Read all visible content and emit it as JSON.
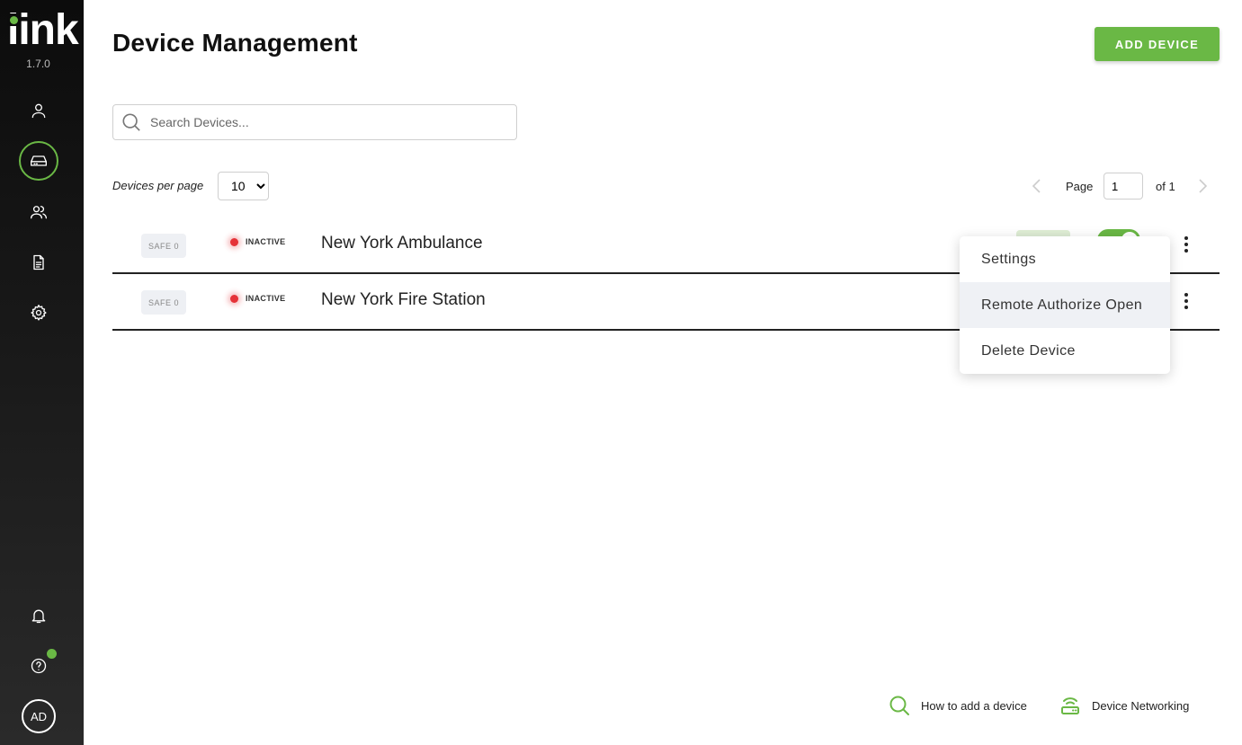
{
  "app": {
    "logo_text": "link",
    "version": "1.7.0",
    "accent_color": "#6ab845"
  },
  "sidebar": {
    "items": [
      {
        "name": "profile",
        "icon": "user-icon",
        "active": false
      },
      {
        "name": "devices",
        "icon": "device-icon",
        "active": true
      },
      {
        "name": "users",
        "icon": "users-icon",
        "active": false
      },
      {
        "name": "logs",
        "icon": "document-icon",
        "active": false
      },
      {
        "name": "settings",
        "icon": "gear-icon",
        "active": false
      }
    ],
    "bottom": {
      "notifications_icon": "bell-icon",
      "help_icon": "help-icon",
      "help_badge": true,
      "avatar_initials": "AD"
    }
  },
  "header": {
    "title": "Device Management",
    "add_button_label": "ADD DEVICE"
  },
  "search": {
    "placeholder": "Search Devices...",
    "value": ""
  },
  "pagination": {
    "per_page_label": "Devices per page",
    "per_page_value": "10",
    "page_label": "Page",
    "current_page": "1",
    "of_label": "of 1"
  },
  "devices": [
    {
      "safe_label": "SAFE 0",
      "status": "INACTIVE",
      "status_color": "#e53238",
      "name": "New York Ambulance"
    },
    {
      "safe_label": "SAFE 0",
      "status": "INACTIVE",
      "status_color": "#e53238",
      "name": "New York Fire Station"
    }
  ],
  "context_menu": {
    "items": [
      {
        "label": "Settings"
      },
      {
        "label": "Remote Authorize Open"
      },
      {
        "label": "Delete Device"
      }
    ]
  },
  "footer": {
    "links": [
      {
        "label": "How to add a device",
        "icon": "search-icon"
      },
      {
        "label": "Device Networking",
        "icon": "router-icon"
      }
    ]
  }
}
